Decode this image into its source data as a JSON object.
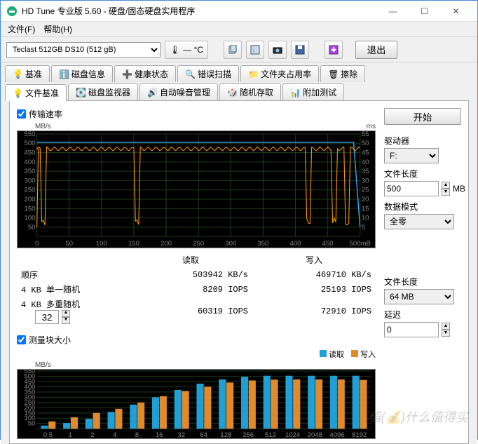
{
  "window": {
    "title": "HD Tune 专业版 5.60 - 硬盘/固态硬盘实用程序"
  },
  "menu": {
    "file": "文件(F)",
    "help": "帮助(H)"
  },
  "toolbar": {
    "drive_selected": "Teclast 512GB DS10 (512 gB)",
    "temp": "— °C",
    "exit": "退出"
  },
  "tabs_row1": [
    {
      "label": "基准",
      "icon": "bulb"
    },
    {
      "label": "磁盘信息",
      "icon": "info"
    },
    {
      "label": "健康状态",
      "icon": "health"
    },
    {
      "label": "错误扫描",
      "icon": "scan"
    },
    {
      "label": "文件夹占用率",
      "icon": "folder"
    },
    {
      "label": "擦除",
      "icon": "erase"
    }
  ],
  "tabs_row2": [
    {
      "label": "文件基准",
      "icon": "bulb2",
      "active": true
    },
    {
      "label": "磁盘监视器",
      "icon": "monitor"
    },
    {
      "label": "自动噪音管理",
      "icon": "sound"
    },
    {
      "label": "随机存取",
      "icon": "random"
    },
    {
      "label": "附加测试",
      "icon": "extra"
    }
  ],
  "panel": {
    "transfer_rate": "传输速率",
    "block_size_label": "测量块大小",
    "start": "开始",
    "drive_label": "驱动器",
    "drive_value": "F:",
    "file_len_label": "文件长度",
    "file_len_value": "500",
    "file_len_unit": "MB",
    "data_mode_label": "数据模式",
    "data_mode_value": "全零",
    "file_len2_label": "文件长度",
    "file_len2_value": "64 MB",
    "delay_label": "延迟",
    "delay_value": "0"
  },
  "results": {
    "header_read": "读取",
    "header_write": "写入",
    "row1_label": "顺序",
    "row1_read": "503942 KB/s",
    "row1_write": "469710 KB/s",
    "row2_label": "4 KB 单一随机",
    "row2_read": "8209 IOPS",
    "row2_write": "25193 IOPS",
    "row3_label": "4 KB 多重随机",
    "row3_spin": "32",
    "row3_read": "60319 IOPS",
    "row3_write": "72910 IOPS"
  },
  "legend": {
    "read": "读取",
    "write": "写入"
  },
  "chart_data": [
    {
      "type": "line",
      "title": "传输速率",
      "xlabel": "mB",
      "ylabel_left": "MB/s",
      "ylabel_right": "ms",
      "xlim": [
        0,
        500
      ],
      "ylim_left": [
        0,
        550
      ],
      "ylim_right": [
        0,
        55
      ],
      "x_ticks": [
        0,
        50,
        100,
        150,
        200,
        250,
        300,
        350,
        400,
        450,
        "500mB"
      ],
      "y_ticks_left": [
        50,
        100,
        150,
        200,
        250,
        300,
        350,
        400,
        450,
        500,
        550
      ],
      "y_ticks_right": [
        5,
        10,
        15,
        20,
        25,
        30,
        35,
        40,
        45,
        50,
        55
      ],
      "series": [
        {
          "name": "读取 (blue)",
          "approx": "mostly ~505 MB/s flat, drop to ~50 at x≈500"
        },
        {
          "name": "写入 (orange)",
          "approx": "hovers 460-490 MB/s with deep dips to ~50 near x≈10,155,420,460,480"
        }
      ]
    },
    {
      "type": "bar",
      "title": "测量块大小",
      "ylabel": "MB/s",
      "ylim": [
        0,
        550
      ],
      "y_ticks": [
        50,
        100,
        150,
        200,
        250,
        300,
        350,
        400,
        450,
        500,
        550
      ],
      "categories": [
        "0.5",
        "1",
        "2",
        "4",
        "8",
        "16",
        "32",
        "64",
        "128",
        "256",
        "512",
        "1024",
        "2048",
        "4096",
        "8192"
      ],
      "series": [
        {
          "name": "读取",
          "color": "#1f9fd6",
          "values": [
            30,
            55,
            95,
            160,
            230,
            300,
            370,
            430,
            470,
            495,
            505,
            505,
            505,
            505,
            505
          ]
        },
        {
          "name": "写入",
          "color": "#e08a2a",
          "values": [
            70,
            110,
            150,
            190,
            250,
            310,
            360,
            400,
            440,
            460,
            468,
            470,
            470,
            470,
            465
          ]
        }
      ]
    }
  ],
  "watermark": "值(💰)什么值得买"
}
